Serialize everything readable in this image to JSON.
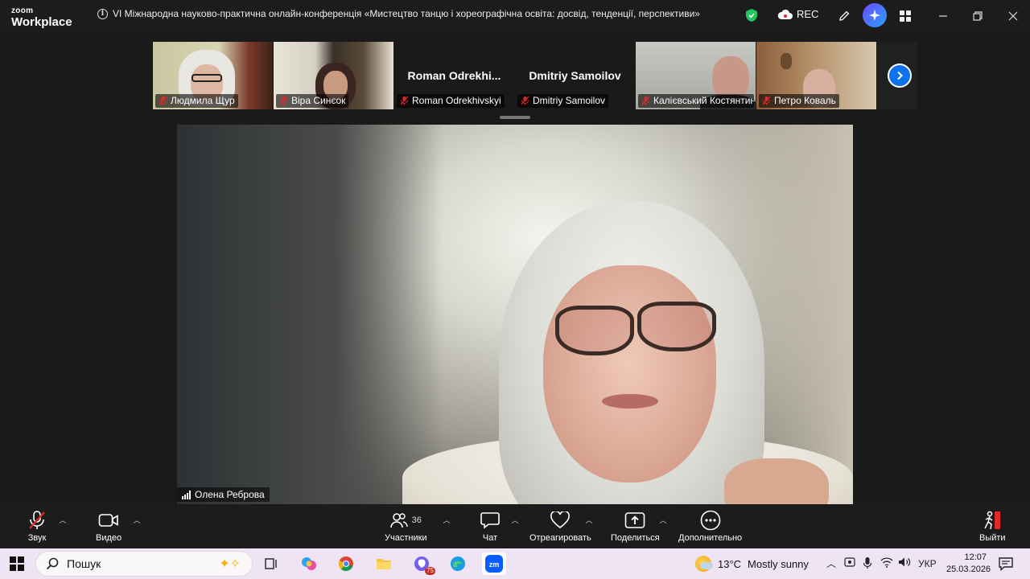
{
  "app": {
    "logo_top": "zoom",
    "logo_bottom": "Workplace",
    "meeting_title": "VI Міжнародна науково-практична онлайн-конференція «Мистецтво танцю і хореографічна освіта: досвід, тенденції, перспективи»",
    "rec_label": "REC"
  },
  "participants": [
    {
      "name": "Людмила Щур",
      "muted": true,
      "video": true
    },
    {
      "name": "Віра Синєок",
      "muted": true,
      "video": true
    },
    {
      "name": "Roman Odrekhivskyi",
      "display": "Roman  Odrekhi...",
      "muted": true,
      "video": false
    },
    {
      "name": "Dmitriy Samoilov",
      "display": "Dmitriy Samoilov",
      "muted": true,
      "video": false
    },
    {
      "name": "Калієвський Костянтин",
      "muted": true,
      "video": true
    },
    {
      "name": "Петро Коваль",
      "muted": true,
      "video": true
    }
  ],
  "speaker": {
    "name": "Олена Реброва"
  },
  "toolbar": {
    "audio_label": "Звук",
    "video_label": "Видео",
    "participants_label": "Участники",
    "participants_count": "36",
    "chat_label": "Чат",
    "react_label": "Отреагировать",
    "share_label": "Поделиться",
    "more_label": "Дополнительно",
    "leave_label": "Выйти"
  },
  "taskbar": {
    "search_placeholder": "Пошук",
    "badge_count": "75",
    "weather_temp": "13°C",
    "weather_desc": "Mostly sunny",
    "language": "УКР",
    "time": "12:07",
    "date": "25.03.2026"
  },
  "colors": {
    "accent_blue": "#0e72ed",
    "mute_red": "#e02828",
    "shield_green": "#22c55e"
  }
}
